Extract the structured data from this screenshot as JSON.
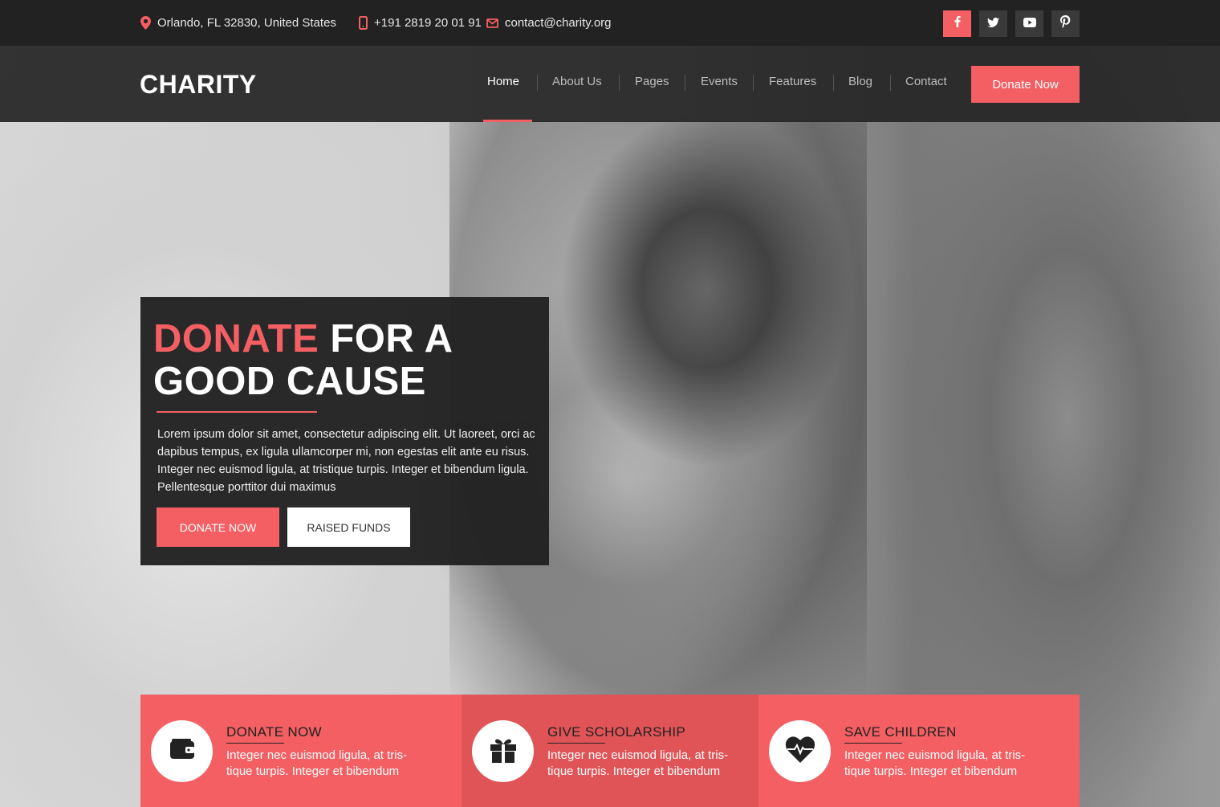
{
  "topbar": {
    "address": "Orlando, FL 32830, United States",
    "phone": "+191 2819 20 01 91",
    "email": "contact@charity.org",
    "social": [
      "facebook-icon",
      "twitter-icon",
      "youtube-icon",
      "pinterest-icon"
    ]
  },
  "nav": {
    "logo": "CHARITY",
    "items": [
      "Home",
      "About Us",
      "Pages",
      "Events",
      "Features",
      "Blog",
      "Contact"
    ],
    "active": "Home",
    "cta": "Donate Now"
  },
  "hero": {
    "title_accent": "DONATE",
    "title_rest_line1": " FOR A",
    "title_line2": "GOOD CAUSE",
    "text": "Lorem ipsum dolor sit amet, consectetur adipiscing elit. Ut laoreet, orci ac dapibus tempus, ex ligula ullamcorper mi, non egestas elit ante eu risus. Integer nec euismod ligula, at tristique turpis. Integer et bibendum ligula. Pellentesque porttitor dui maximus",
    "btn_primary": "DONATE NOW",
    "btn_secondary": "RAISED FUNDS"
  },
  "features": [
    {
      "title": "DONATE NOW",
      "text": "Integer nec euismod ligula, at tris-tique turpis. Integer et bibendum",
      "icon": "wallet-icon"
    },
    {
      "title": "GIVE SCHOLARSHIP",
      "text": "Integer nec euismod ligula, at tris-tique turpis. Integer et bibendum",
      "icon": "gift-icon"
    },
    {
      "title": "SAVE CHILDREN",
      "text": "Integer nec euismod ligula, at tris-tique turpis. Integer et bibendum",
      "icon": "heartbeat-icon"
    }
  ],
  "colors": {
    "accent": "#f35f63",
    "accent_dark": "#e05458",
    "topbar_bg": "#222222",
    "navbar_bg": "#262626",
    "card_bg": "#212121"
  }
}
